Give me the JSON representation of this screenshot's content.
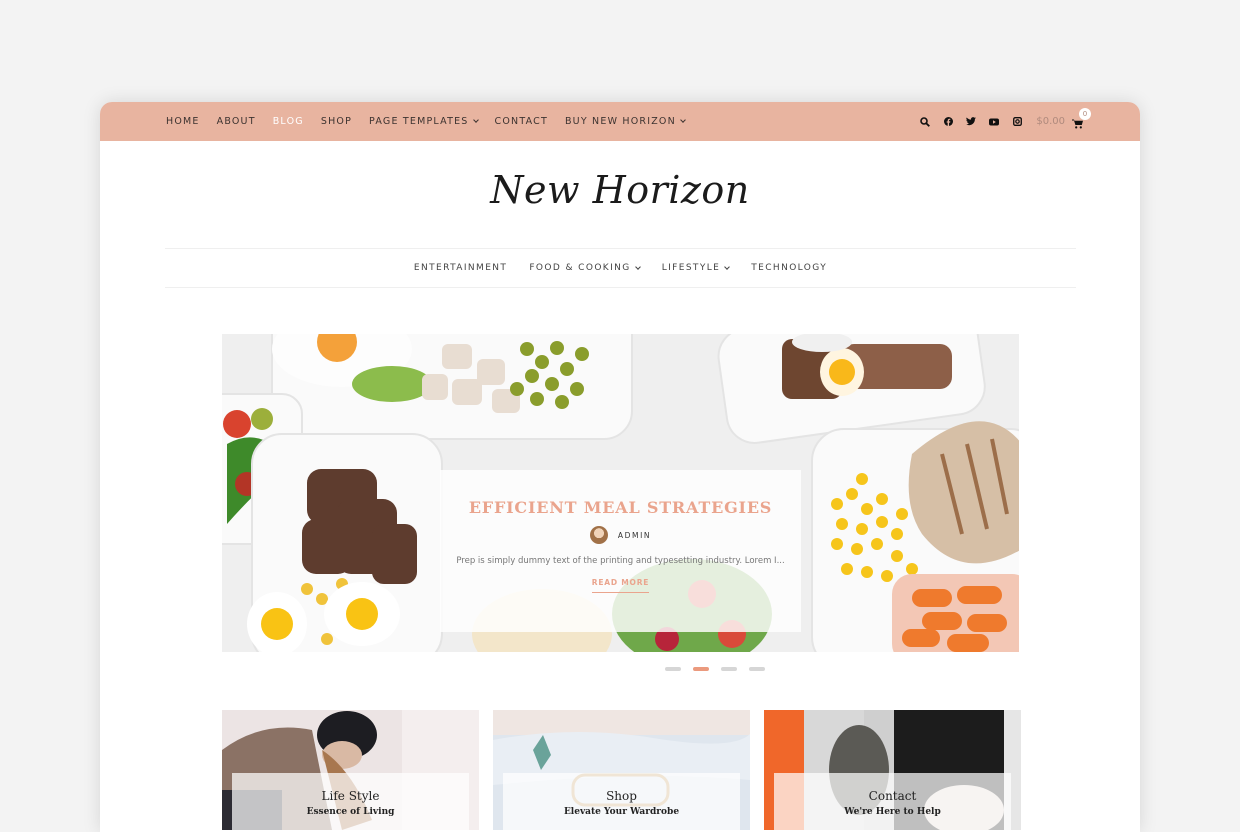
{
  "topbar": {
    "nav": [
      {
        "label": "HOME",
        "dropdown": false,
        "active": false
      },
      {
        "label": "ABOUT",
        "dropdown": false,
        "active": false
      },
      {
        "label": "BLOG",
        "dropdown": false,
        "active": true
      },
      {
        "label": "SHOP",
        "dropdown": false,
        "active": false
      },
      {
        "label": "PAGE TEMPLATES",
        "dropdown": true,
        "active": false
      },
      {
        "label": "CONTACT",
        "dropdown": false,
        "active": false
      },
      {
        "label": "BUY NEW HORIZON",
        "dropdown": true,
        "active": false
      }
    ],
    "icons": [
      "search-icon",
      "facebook-icon",
      "twitter-icon",
      "youtube-icon",
      "instagram-icon"
    ],
    "cart_total": "$0.00",
    "cart_count": "0",
    "bg_color": "#e8b4a0"
  },
  "logo": {
    "text": "New Horizon"
  },
  "categories": [
    {
      "label": "ENTERTAINMENT",
      "dropdown": false
    },
    {
      "label": "FOOD & COOKING",
      "dropdown": true
    },
    {
      "label": "LIFESTYLE",
      "dropdown": true
    },
    {
      "label": "TECHNOLOGY",
      "dropdown": false
    }
  ],
  "hero": {
    "title": "EFFICIENT MEAL STRATEGIES",
    "author": "ADMIN",
    "excerpt": "Prep is simply dummy text of the printing and typesetting industry. Lorem I...",
    "read_more": "READ MORE",
    "accent_color": "#eaa48d",
    "slides_total": 4,
    "active_slide": 2
  },
  "cards": [
    {
      "title": "Life Style",
      "subtitle": "Essence of Living"
    },
    {
      "title": "Shop",
      "subtitle": "Elevate Your Wardrobe"
    },
    {
      "title": "Contact",
      "subtitle": "We're Here to Help"
    }
  ]
}
